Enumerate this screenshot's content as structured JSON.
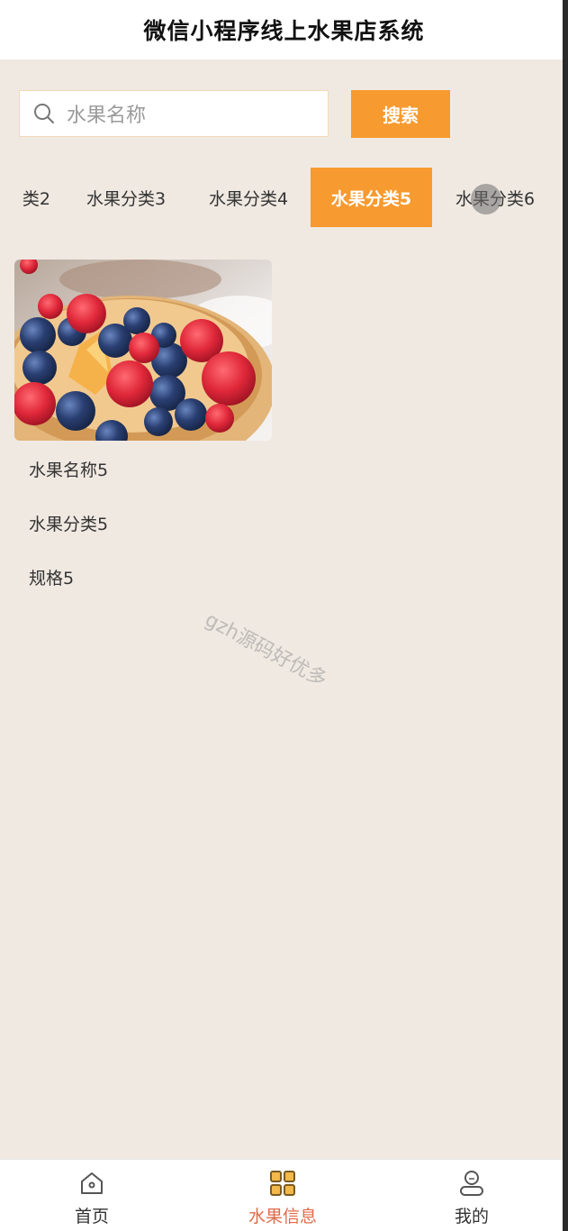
{
  "header": {
    "title": "微信小程序线上水果店系统"
  },
  "search": {
    "placeholder": "水果名称",
    "button_label": "搜索"
  },
  "categories": {
    "tabs": [
      {
        "label": "类2"
      },
      {
        "label": "水果分类3"
      },
      {
        "label": "水果分类4"
      },
      {
        "label": "水果分类5"
      },
      {
        "label": "水果分类6"
      }
    ],
    "active_index": 3
  },
  "product": {
    "name": "水果名称5",
    "category": "水果分类5",
    "spec": "规格5"
  },
  "watermark": "gzh源码好优多",
  "nav": {
    "items": [
      {
        "label": "首页",
        "icon": "home-icon"
      },
      {
        "label": "水果信息",
        "icon": "grid-icon"
      },
      {
        "label": "我的",
        "icon": "user-icon"
      }
    ],
    "active_index": 1
  },
  "colors": {
    "accent": "#f79a2f",
    "background": "#f0e9e2",
    "nav_active": "#e06a4a"
  }
}
